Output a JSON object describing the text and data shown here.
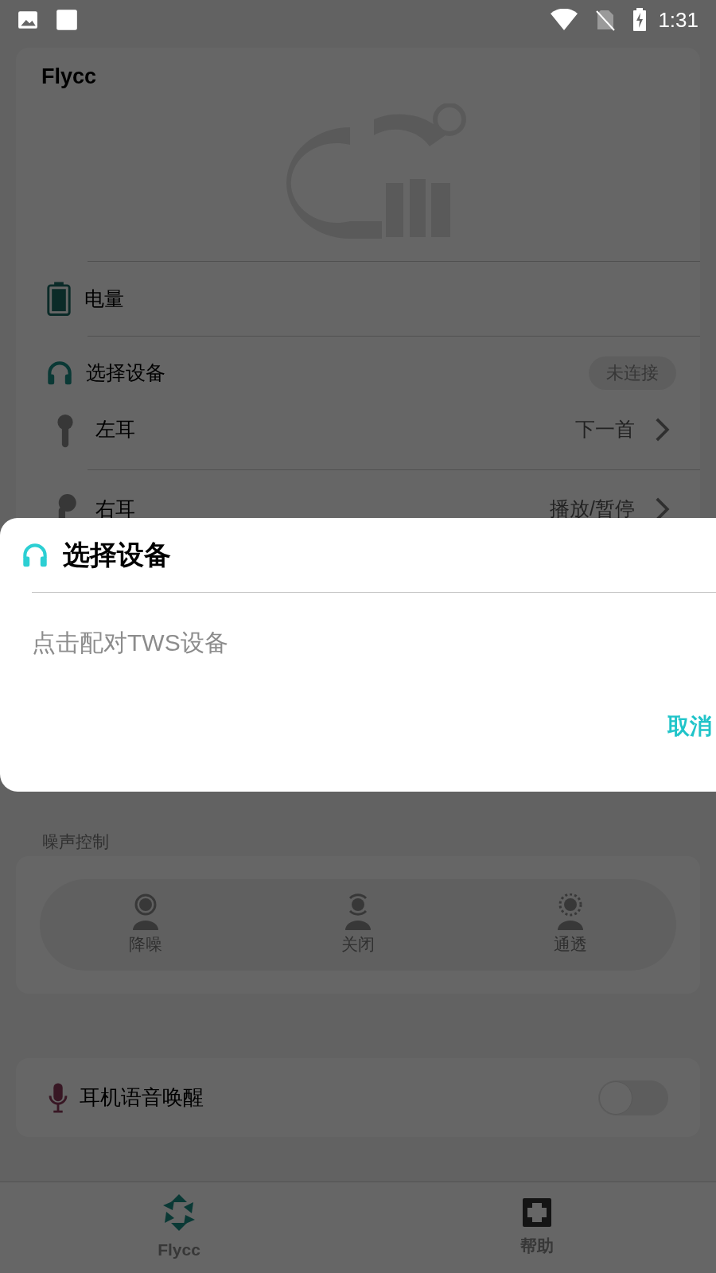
{
  "status_bar": {
    "time": "1:31"
  },
  "header_card": {
    "title": "Flycc",
    "rows": [
      {
        "kind": "battery",
        "label": "电量"
      },
      {
        "kind": "device",
        "label": "选择设备",
        "badge": "未连接"
      }
    ]
  },
  "ear_rows": [
    {
      "kind": "left",
      "label": "左耳",
      "value": "下一首"
    },
    {
      "kind": "right",
      "label": "右耳",
      "value": "播放/暂停"
    }
  ],
  "noise_control": {
    "label": "噪声控制",
    "modes": [
      {
        "kind": "anc",
        "label": "降噪"
      },
      {
        "kind": "off",
        "label": "关闭"
      },
      {
        "kind": "transparent",
        "label": "通透"
      }
    ]
  },
  "voice_wakeup": {
    "label": "耳机语音唤醒",
    "on": false
  },
  "bottom_nav": [
    {
      "label": "Flycc",
      "selected": true
    },
    {
      "label": "帮助",
      "selected": false
    }
  ],
  "dialog": {
    "title": "选择设备",
    "message": "点击配对TWS设备",
    "button": "取消"
  }
}
